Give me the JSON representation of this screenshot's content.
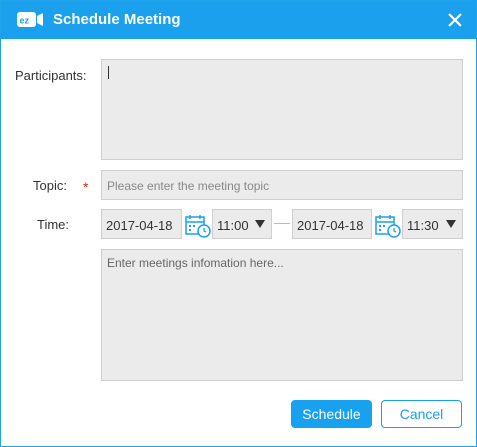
{
  "dialog": {
    "title": "Schedule Meeting",
    "logo_text": "ez",
    "accent_color": "#1aa0ec",
    "required_color": "#e2231a"
  },
  "form": {
    "participants_label": "Participants:",
    "participants_value": "",
    "topic_label": "Topic:",
    "topic_required_mark": "*",
    "topic_placeholder": "Please enter the meeting topic",
    "time_label": "Time:",
    "start_date": "2017-04-18",
    "start_time": "11:00",
    "end_date": "2017-04-18",
    "end_time": "11:30",
    "info_placeholder": "Enter meetings infomation here..."
  },
  "buttons": {
    "schedule": "Schedule",
    "cancel": "Cancel"
  },
  "icons": {
    "logo": "ez-camera-logo-icon",
    "close": "close-icon",
    "calendar": "calendar-clock-icon",
    "dropdown": "triangle-down-icon"
  }
}
